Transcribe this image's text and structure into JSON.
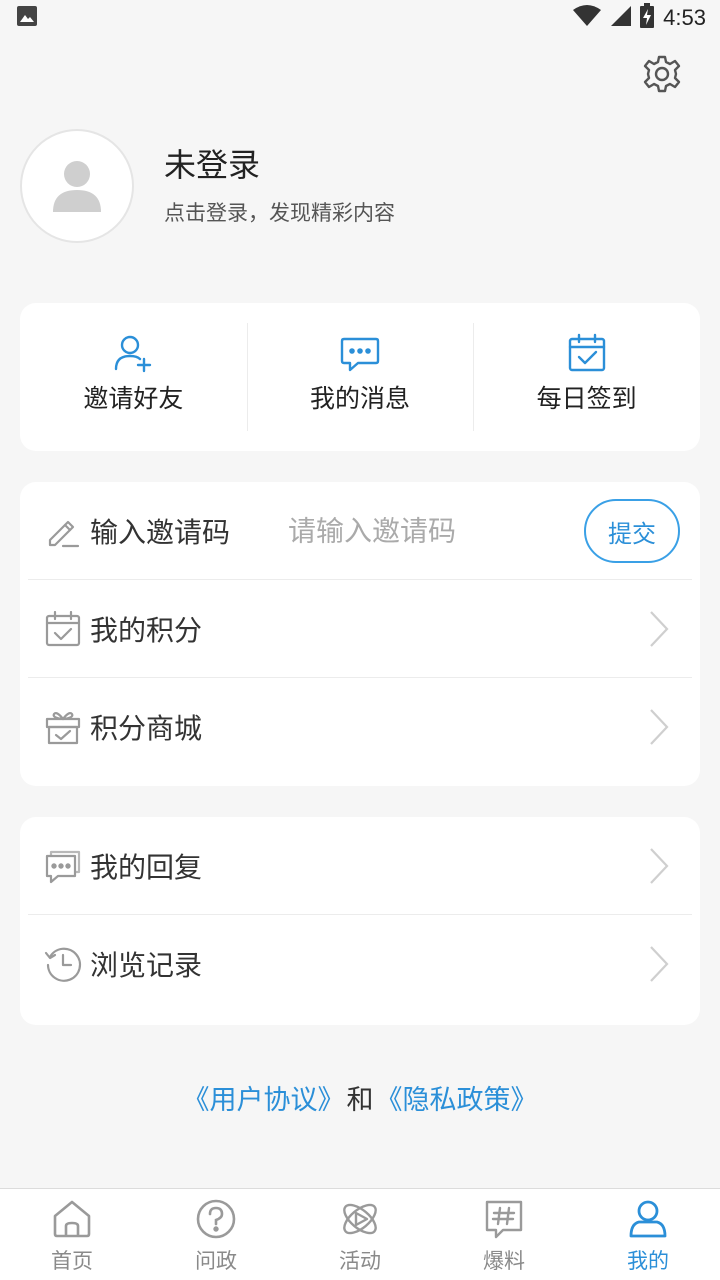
{
  "status_bar": {
    "time": "4:53",
    "icons": [
      "image-notification-icon",
      "wifi-icon",
      "signal-icon",
      "battery-charging-icon"
    ]
  },
  "header": {
    "settings_icon": "gear-icon"
  },
  "profile": {
    "name": "未登录",
    "subtitle": "点击登录，发现精彩内容",
    "avatar_icon": "user-silhouette-icon"
  },
  "quick_actions": [
    {
      "label": "邀请好友",
      "icon": "add-user-icon"
    },
    {
      "label": "我的消息",
      "icon": "chat-bubble-icon"
    },
    {
      "label": "每日签到",
      "icon": "calendar-check-icon"
    }
  ],
  "invite": {
    "label": "输入邀请码",
    "placeholder": "请输入邀请码",
    "value": "",
    "submit_label": "提交",
    "icon": "pencil-icon"
  },
  "list1": [
    {
      "label": "我的积分",
      "icon": "calendar-check-icon"
    },
    {
      "label": "积分商城",
      "icon": "gift-box-icon"
    }
  ],
  "list2": [
    {
      "label": "我的回复",
      "icon": "chat-bubble-icon"
    },
    {
      "label": "浏览记录",
      "icon": "history-clock-icon"
    }
  ],
  "agreement": {
    "user_agreement": "《用户协议》",
    "and": "和",
    "privacy_policy": "《隐私政策》"
  },
  "tabs": [
    {
      "label": "首页",
      "icon": "home-icon",
      "active": false
    },
    {
      "label": "问政",
      "icon": "question-circle-icon",
      "active": false
    },
    {
      "label": "活动",
      "icon": "orbit-play-icon",
      "active": false
    },
    {
      "label": "爆料",
      "icon": "hashtag-bubble-icon",
      "active": false
    },
    {
      "label": "我的",
      "icon": "user-icon",
      "active": true
    }
  ],
  "colors": {
    "accent": "#2b8fd8",
    "background": "#f6f6f6",
    "card": "#ffffff",
    "icon_gray": "#9a9a9a"
  }
}
